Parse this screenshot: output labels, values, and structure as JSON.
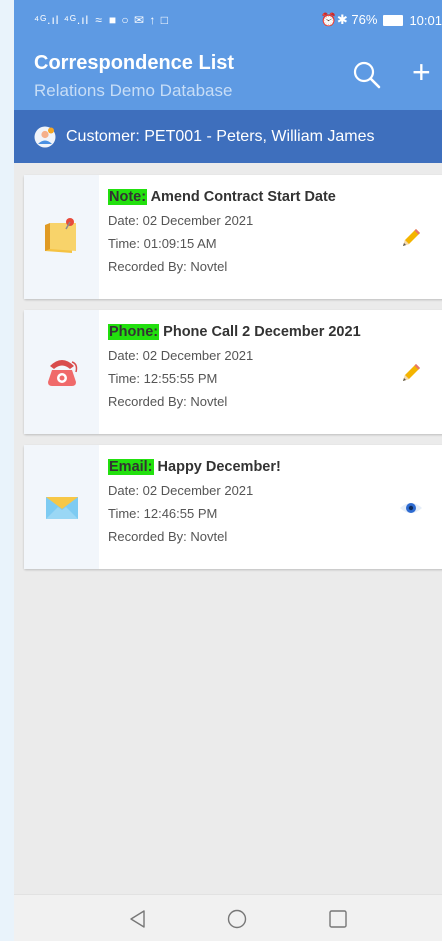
{
  "status_bar": {
    "signal_text": "⁴ᴳ.ıl ⁴ᴳ.ıl",
    "right_text": "⏰✱ 76%",
    "time": "10:01"
  },
  "app_bar": {
    "title": "Correspondence List",
    "subtitle": "Relations Demo Database",
    "search_icon": "search-icon",
    "add_label": "+"
  },
  "customer_bar": {
    "label": "Customer: PET001 - Peters, William James"
  },
  "items": [
    {
      "type": "Note:",
      "subject": "Amend Contract Start Date",
      "date": "Date: 02 December 2021",
      "time": "Time: 01:09:15 AM",
      "recorded": "Recorded By: Novtel",
      "icon": "note-icon",
      "action_icon": "pencil-icon"
    },
    {
      "type": "Phone:",
      "subject": "Phone Call 2 December 2021",
      "date": "Date: 02 December 2021",
      "time": "Time: 12:55:55 PM",
      "recorded": "Recorded By: Novtel",
      "icon": "phone-icon",
      "action_icon": "pencil-icon"
    },
    {
      "type": "Email:",
      "subject": "Happy December!",
      "date": "Date: 02 December 2021",
      "time": "Time: 12:46:55 PM",
      "recorded": "Recorded By: Novtel",
      "icon": "email-icon",
      "action_icon": "eye-icon"
    }
  ],
  "colors": {
    "app_bar": "#5e9ae3",
    "customer_bar": "#3e6fbd",
    "type_highlight": "#22e00e"
  }
}
